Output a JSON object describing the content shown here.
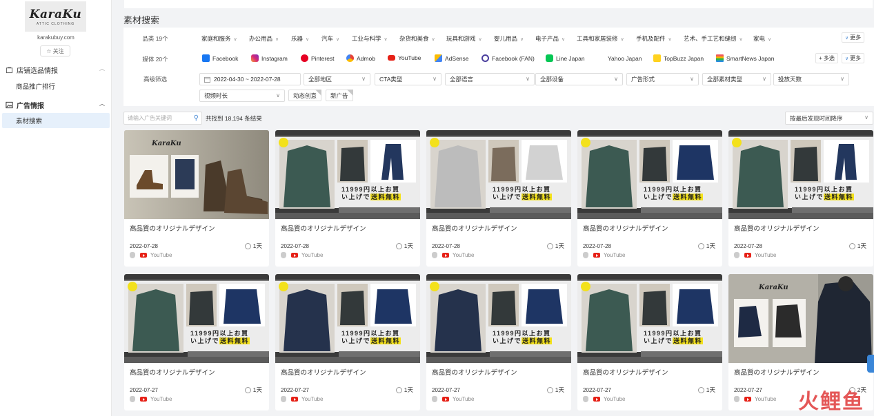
{
  "sidebar": {
    "logo_text": "KaraKu",
    "logo_sub": "ATTIC CLOTHING",
    "domain": "karakubuy.com",
    "follow_label": "☆ 关注",
    "groups": [
      {
        "label": "店铺选品情报",
        "items": [
          "商品推广排行"
        ]
      },
      {
        "label": "广告情报",
        "items": [
          "素材搜索"
        ]
      }
    ]
  },
  "main": {
    "title": "素材搜索",
    "filters": {
      "category_label": "品类 19个",
      "categories": [
        "家庭和服务",
        "办公用品",
        "乐器",
        "汽车",
        "工业与科学",
        "杂货和美食",
        "玩具和游戏",
        "婴儿用品",
        "电子产品",
        "工具和家居装修",
        "手机及配件",
        "艺术、手工艺和缝纫",
        "家电"
      ],
      "more_label": "更多",
      "media_label": "媒体 20个",
      "media": [
        "Facebook",
        "Instagram",
        "Pinterest",
        "Admob",
        "YouTube",
        "AdSense",
        "Facebook (FAN)",
        "Line Japan",
        "Yahoo Japan",
        "TopBuzz Japan",
        "SmartNews Japan"
      ],
      "multi_label": "+ 多选",
      "advanced_label": "高级筛选",
      "date_range": "2022-04-30 ~ 2022-07-28",
      "selects": [
        "全部地区",
        "CTA类型",
        "全部语言",
        "全部设备",
        "广告形式",
        "全部素材类型",
        "投放天数",
        "视频时长"
      ],
      "tags": [
        "动态创意",
        "新广告"
      ]
    },
    "search_placeholder": "请输入广告关键词",
    "result_count": "共找到 18,194 条结果",
    "sort_label": "按最后发现时间降序"
  },
  "cards": [
    {
      "title": "高品質のオリジナルデザイン",
      "date": "2022-07-28",
      "duration": "1天",
      "platform": "YouTube",
      "thumb": "boots"
    },
    {
      "title": "高品質のオリジナルデザイン",
      "date": "2022-07-28",
      "duration": "1天",
      "platform": "YouTube",
      "thumb": "jacket"
    },
    {
      "title": "高品質のオリジナルデザイン",
      "date": "2022-07-28",
      "duration": "1天",
      "platform": "YouTube",
      "thumb": "bomber"
    },
    {
      "title": "高品質のオリジナルデザイン",
      "date": "2022-07-28",
      "duration": "1天",
      "platform": "YouTube",
      "thumb": "denim"
    },
    {
      "title": "高品質のオリジナルデザイン",
      "date": "2022-07-28",
      "duration": "1天",
      "platform": "YouTube",
      "thumb": "jacket"
    },
    {
      "title": "高品質のオリジナルデザイン",
      "date": "2022-07-27",
      "duration": "1天",
      "platform": "YouTube",
      "thumb": "denim"
    },
    {
      "title": "高品質のオリジナルデザイン",
      "date": "2022-07-27",
      "duration": "1天",
      "platform": "YouTube",
      "thumb": "denim2"
    },
    {
      "title": "高品質のオリジナルデザイン",
      "date": "2022-07-27",
      "duration": "1天",
      "platform": "YouTube",
      "thumb": "denim2"
    },
    {
      "title": "高品質のオリジナルデザイン",
      "date": "2022-07-27",
      "duration": "1天",
      "platform": "YouTube",
      "thumb": "denim"
    },
    {
      "title": "高品質のオリジナルデザイン",
      "date": "2022-07-27",
      "duration": "2天",
      "platform": "YouTube",
      "thumb": "brand"
    }
  ],
  "banner_text_line1": "11999円以上お買",
  "banner_text_line2a": "い上げで",
  "banner_text_line2b": "送料無料",
  "watermark": "火鲤鱼"
}
